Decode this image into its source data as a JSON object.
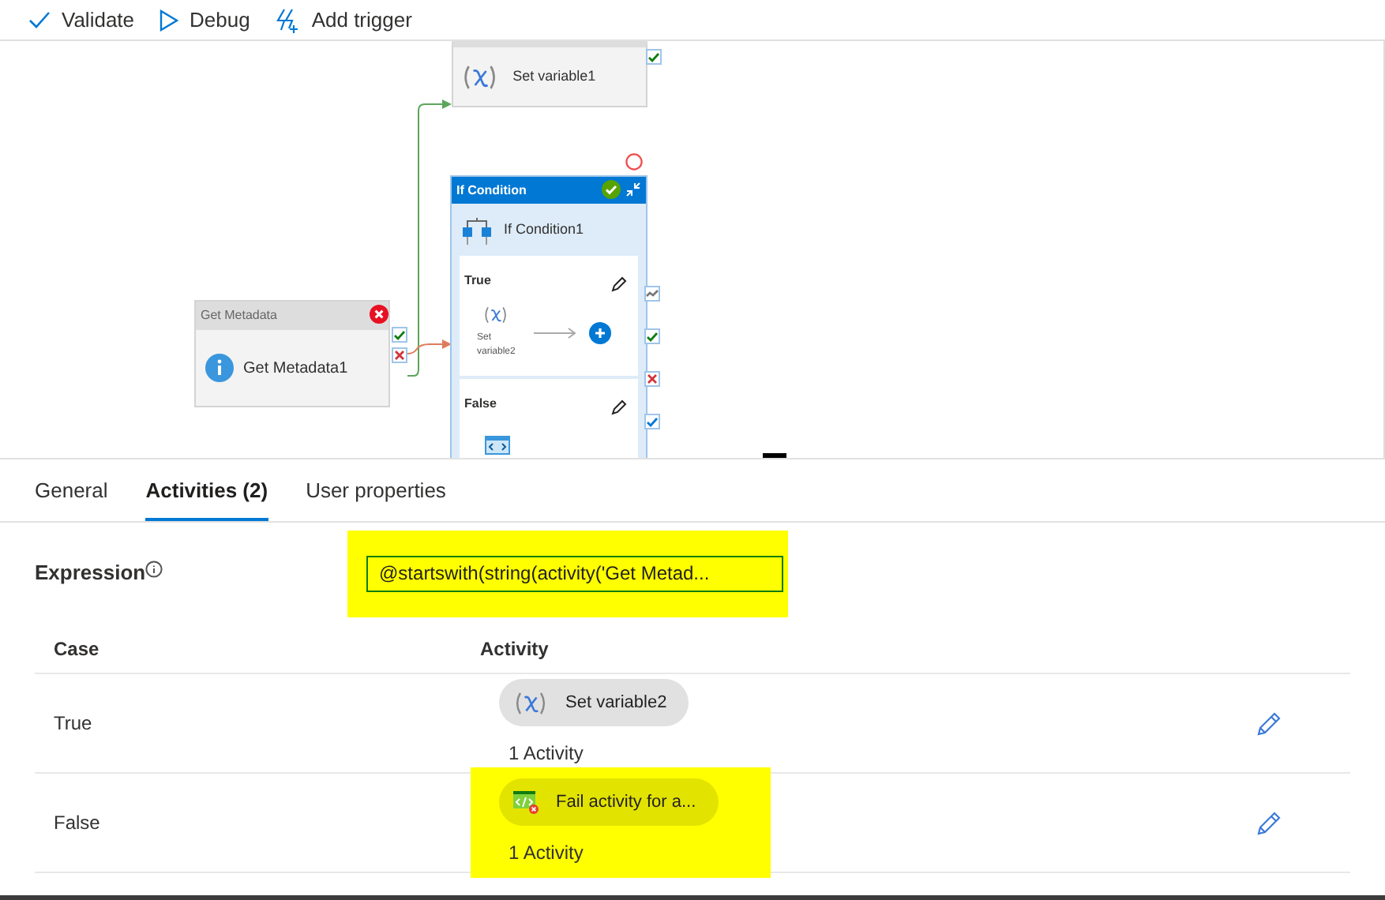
{
  "toolbar": [
    {
      "label": "Validate",
      "kind": "validate"
    },
    {
      "label": "Debug",
      "kind": "debug"
    },
    {
      "label": "Add trigger",
      "kind": "trigger"
    }
  ],
  "canvas": {
    "set_variable_node": {
      "label": "Set variable1",
      "ports": [
        {
          "kind": "success"
        }
      ]
    },
    "get_metadata_node": {
      "header": "Get Metadata",
      "label": "Get Metadata1",
      "failed": true,
      "ports": [
        {
          "kind": "success"
        },
        {
          "kind": "failure"
        }
      ]
    },
    "if_condition_node": {
      "header": "If Condition",
      "label": "If Condition1",
      "succeeded": true,
      "ports": [
        {
          "kind": "skipped"
        },
        {
          "kind": "success"
        },
        {
          "kind": "failure"
        },
        {
          "kind": "completion"
        }
      ],
      "branches": [
        {
          "title": "True",
          "activity": "Set variable2",
          "kind": "variable"
        },
        {
          "title": "False",
          "kind": "script"
        }
      ]
    }
  },
  "tabs": [
    {
      "label": "General",
      "selected": false
    },
    {
      "label": "Activities (2)",
      "selected": true
    },
    {
      "label": "User properties",
      "selected": false
    }
  ],
  "expression": {
    "label": "Expression",
    "value": "@startswith(string(activity('Get Metad...",
    "highlighted": true
  },
  "table": {
    "columns": [
      "Case",
      "Activity"
    ],
    "rows": [
      {
        "case": "True",
        "activity": "Set variable2",
        "kind": "variable",
        "count": "1 Activity",
        "highlighted": false
      },
      {
        "case": "False",
        "activity": "Fail activity for a...",
        "kind": "fail",
        "count": "1 Activity",
        "highlighted": true
      }
    ]
  }
}
